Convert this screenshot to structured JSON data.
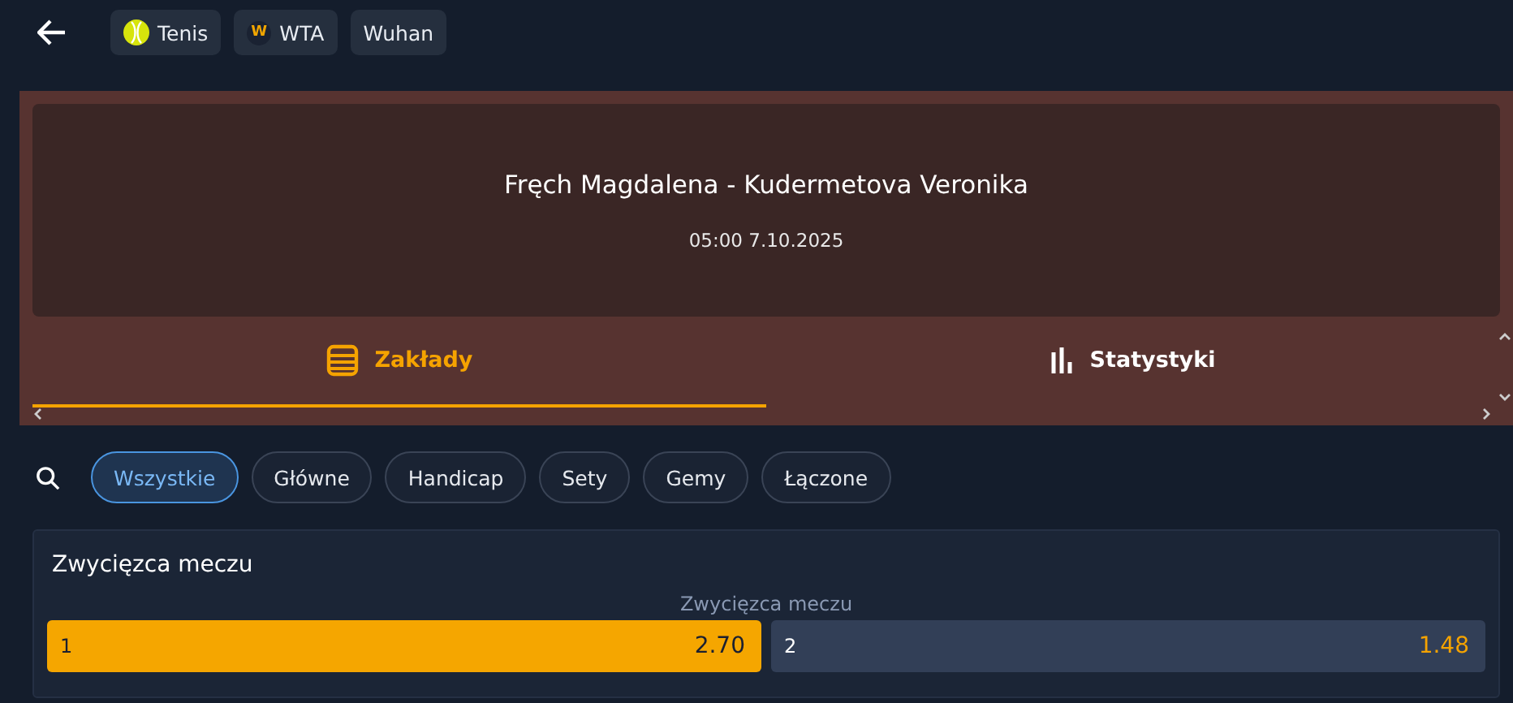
{
  "breadcrumbs": [
    {
      "label": "Tenis",
      "kind": "ball"
    },
    {
      "label": "WTA",
      "kind": "badge",
      "badge": "W"
    },
    {
      "label": "Wuhan",
      "kind": "plain"
    }
  ],
  "match": {
    "title": "Fręch Magdalena - Kudermetova Veronika",
    "time": "05:00 7.10.2025"
  },
  "tabs": [
    {
      "label": "Zakłady",
      "kind": "bets",
      "selected": true
    },
    {
      "label": "Statystyki",
      "kind": "stats",
      "selected": false
    }
  ],
  "filters": [
    {
      "label": "Wszystkie",
      "selected": true
    },
    {
      "label": "Główne",
      "selected": false
    },
    {
      "label": "Handicap",
      "selected": false
    },
    {
      "label": "Sety",
      "selected": false
    },
    {
      "label": "Gemy",
      "selected": false
    },
    {
      "label": "Łączone",
      "selected": false
    }
  ],
  "market": {
    "title": "Zwycięzca meczu",
    "subtitle": "Zwycięzca meczu",
    "odds": [
      {
        "label": "1",
        "price": "2.70",
        "selected": true
      },
      {
        "label": "2",
        "price": "1.48",
        "selected": false
      }
    ]
  }
}
